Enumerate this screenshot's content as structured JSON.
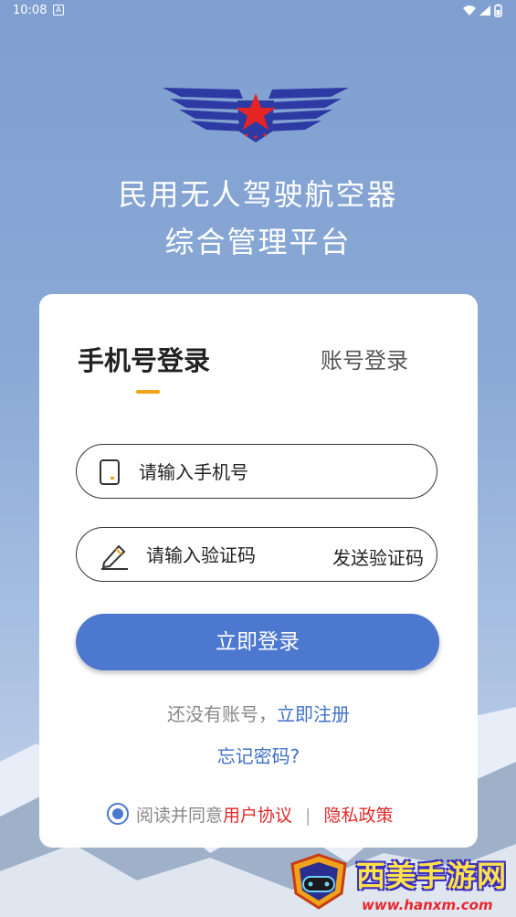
{
  "status_bar": {
    "time": "10:08",
    "notification_glyph": "A"
  },
  "header": {
    "title_line1": "民用无人驾驶航空器",
    "title_line2": "综合管理平台"
  },
  "tabs": {
    "active": "手机号登录",
    "inactive": "账号登录"
  },
  "phone_field": {
    "placeholder": "请输入手机号"
  },
  "code_field": {
    "placeholder": "请输入验证码",
    "send_label": "发送验证码"
  },
  "login_button": "立即登录",
  "register": {
    "prefix": "还没有账号，",
    "link": "立即注册"
  },
  "forgot_password": "忘记密码?",
  "agreement": {
    "text": "阅读并同意",
    "user_agreement": "用户协议",
    "separator": "|",
    "privacy_policy": "隐私政策",
    "checked": true
  },
  "watermark": {
    "title": "西美手游网",
    "url": "www.hanxm.com"
  },
  "colors": {
    "primary": "#4c78cf",
    "accent": "#f2a31a",
    "link": "#3f6fc8",
    "danger": "#e02a2a"
  },
  "icons": [
    "phone-icon",
    "pencil-icon",
    "radio-checked-icon",
    "wing-star-logo",
    "wifi-icon",
    "signal-icon",
    "battery-icon"
  ]
}
